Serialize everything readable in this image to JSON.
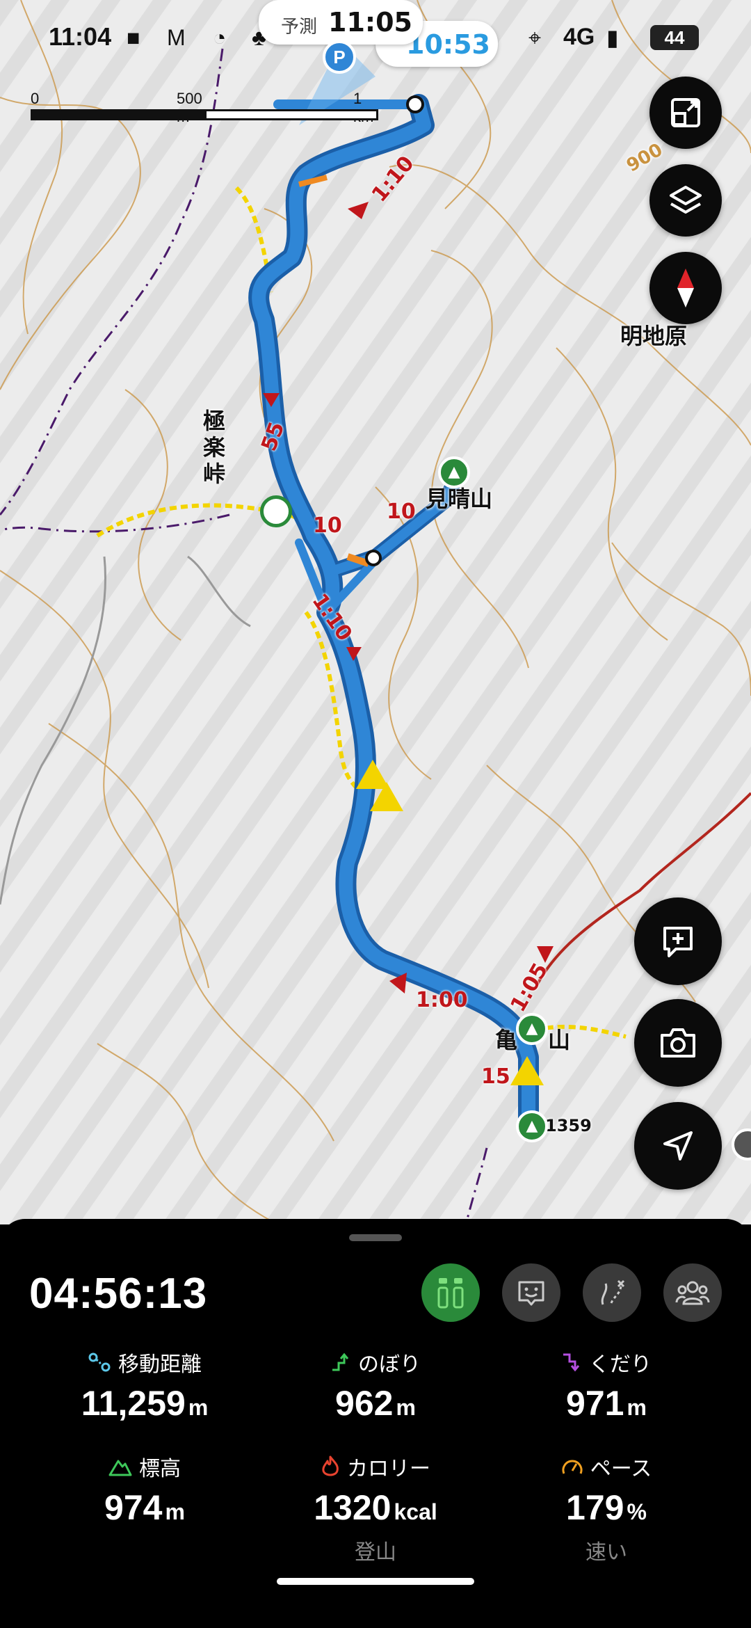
{
  "status_bar": {
    "time": "11:04",
    "network": "4G",
    "battery": "44"
  },
  "forecast": {
    "label": "予測",
    "time": "11:05",
    "eta": "10:53"
  },
  "scale": {
    "zero": "0",
    "mid": "500 m",
    "end": "1 km"
  },
  "map_labels": {
    "gokuraku": "極楽峠",
    "miharashi": "見晴山",
    "meijigahara": "明地原",
    "kame": "亀",
    "kame_suffix": "山",
    "elev_900": "900",
    "elev_1359": "1359"
  },
  "route_labels": {
    "t1": "1:10",
    "t2": "55",
    "t3": "10",
    "t4": "10",
    "t5": "1:10",
    "t6": "1:00",
    "t7": "1:05",
    "t8": "15"
  },
  "map_buttons": [
    "fullscreen-icon",
    "layers-icon",
    "compass-icon",
    "add-memo-icon",
    "camera-icon",
    "navigate-icon"
  ],
  "panel": {
    "elapsed": "04:56:13",
    "modes": [
      "track-mode-icon",
      "face-mode-icon",
      "route-mode-icon",
      "group-icon"
    ],
    "stats": [
      {
        "label": "移動距離",
        "value": "11,259",
        "unit": "m",
        "sub": ""
      },
      {
        "label": "のぼり",
        "value": "962",
        "unit": "m",
        "sub": ""
      },
      {
        "label": "くだり",
        "value": "971",
        "unit": "m",
        "sub": ""
      },
      {
        "label": "標高",
        "value": "974",
        "unit": "m",
        "sub": ""
      },
      {
        "label": "カロリー",
        "value": "1320",
        "unit": "kcal",
        "sub": "登山"
      },
      {
        "label": "ペース",
        "value": "179",
        "unit": "%",
        "sub": "速い"
      }
    ]
  },
  "colors": {
    "route": "#2f86d6",
    "route_outline": "#1b5fa8",
    "accent_green": "#2a8a3a",
    "warning": "#f3d400",
    "contour": "#c9923f"
  }
}
